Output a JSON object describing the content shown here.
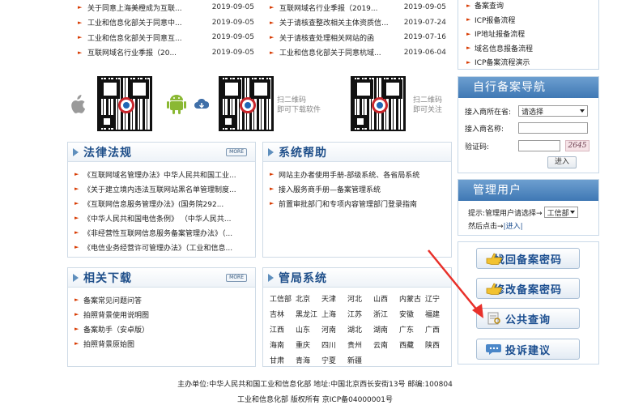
{
  "news_left": [
    {
      "title": "关于同意上海美橙成为互联...",
      "date": "2019-09-05"
    },
    {
      "title": "工业和信息化部关于同意中...",
      "date": "2019-09-05"
    },
    {
      "title": "工业和信息化部关于同意互...",
      "date": "2019-09-05"
    },
    {
      "title": "互联网域名行业季报（20...",
      "date": "2019-09-05"
    }
  ],
  "news_right": [
    {
      "title": "互联网域名行业季报（2019...",
      "date": "2019-09-05"
    },
    {
      "title": "关于请核查整改相关主体资质信...",
      "date": "2019-07-24"
    },
    {
      "title": "关于请核查处理相关网站的函",
      "date": "2019-07-16"
    },
    {
      "title": "工业和信息化部关于同意杭域...",
      "date": "2019-06-04"
    }
  ],
  "top_right_links": [
    "备案查询",
    "ICP报备流程",
    "IP地址报备流程",
    "域名信息报备流程",
    "ICP备案流程演示"
  ],
  "qr": {
    "scan_download_line1": "扫二维码",
    "scan_download_line2": "即可下载软件",
    "scan_follow_line1": "扫二维码",
    "scan_follow_line2": "即可关注"
  },
  "more_label": "MORE",
  "law": {
    "title": "法律法规",
    "items": [
      "《互联网域名管理办法》中华人民共和国工业...",
      "《关于建立境内违法互联网站黑名单管理制度...",
      "《互联网信息服务管理办法》(国务院292...",
      "《中华人民共和国电信条例》 （中华人民共...",
      "《非经营性互联网信息服务备案管理办法》（...",
      "《电信业务经营许可管理办法》（工业和信息..."
    ]
  },
  "help": {
    "title": "系统帮助",
    "items": [
      "网站主办者使用手册-部级系统、各省局系统",
      "接入服务商手册—备案管理系统",
      "前置审批部门和专项内容管理部门登录指南"
    ]
  },
  "downloads": {
    "title": "相关下载",
    "items": [
      "备案常见问题问答",
      "拍照背景使用说明图",
      "备案助手（安卓版）",
      "拍照背景原始图"
    ]
  },
  "bureau": {
    "title": "管局系统",
    "cities": [
      "工信部",
      "北京",
      "天津",
      "河北",
      "山西",
      "内蒙古",
      "辽宁",
      "吉林",
      "黑龙江",
      "上海",
      "江苏",
      "浙江",
      "安徽",
      "福建",
      "江西",
      "山东",
      "河南",
      "湖北",
      "湖南",
      "广东",
      "广西",
      "海南",
      "重庆",
      "四川",
      "贵州",
      "云南",
      "西藏",
      "陕西",
      "甘肃",
      "青海",
      "宁夏",
      "新疆"
    ]
  },
  "self_nav": {
    "title": "自行备案导航",
    "province_label": "接入商所在省:",
    "province_value": "请选择",
    "name_label": "接入商名称:",
    "captcha_label": "验证码:",
    "captcha_text": "2645",
    "enter_label": "进入"
  },
  "admin": {
    "title": "管理用户",
    "hint": "提示:管理用户请选择→",
    "select_value": "工信部",
    "hint2": "然后点击→",
    "enter_link": "|进入|"
  },
  "big_buttons": [
    "找回备案密码",
    "修改备案密码",
    "公共查询",
    "投诉建议"
  ],
  "footer": {
    "line1": "主办单位:中华人民共和国工业和信息化部 地址:中国北京西长安街13号 邮编:100804",
    "line2": "工业和信息化部 版权所有 京ICP备04000001号"
  },
  "colors": {
    "accent_blue": "#3f78b4",
    "title_blue": "#1f4f8a",
    "bullet": "#d83a00",
    "arrow_red": "#e8302a"
  }
}
